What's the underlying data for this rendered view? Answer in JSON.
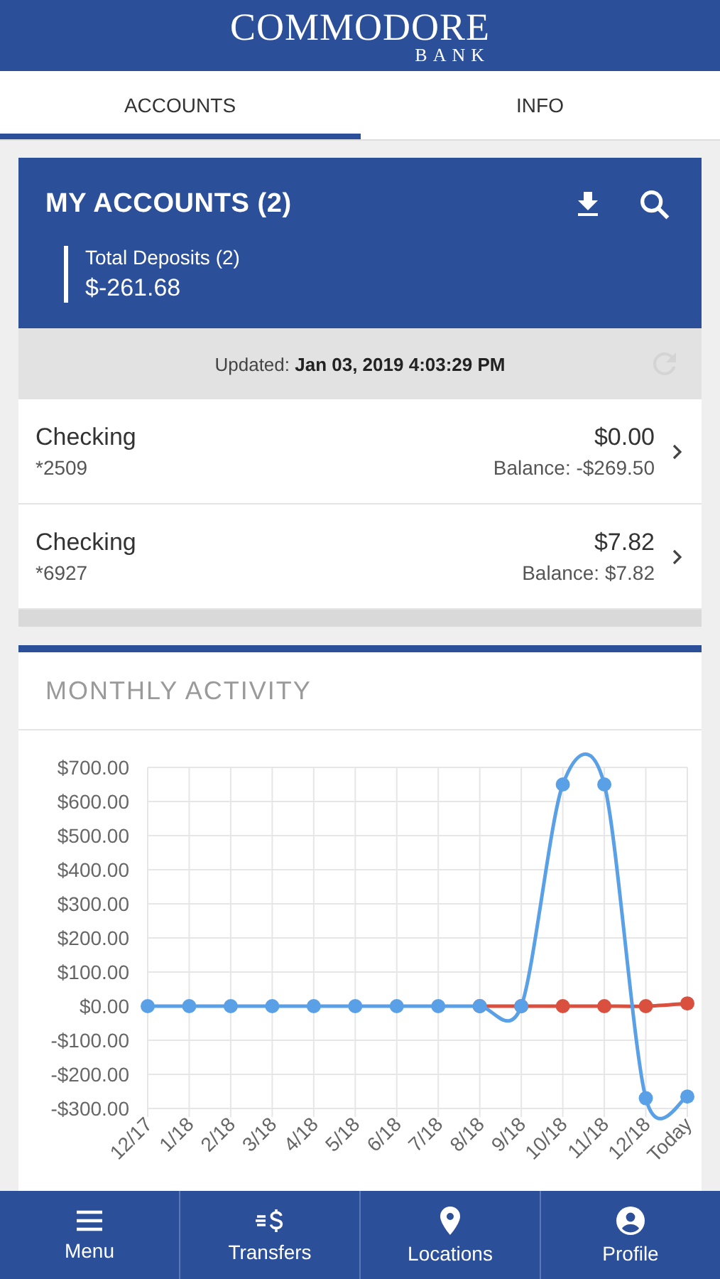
{
  "header": {
    "logo_title": "COMMODORE",
    "logo_subtitle": "BANK"
  },
  "tabs": [
    {
      "label": "ACCOUNTS",
      "selected": true
    },
    {
      "label": "INFO",
      "selected": false
    }
  ],
  "summary": {
    "title": "MY ACCOUNTS (2)",
    "total_label": "Total Deposits (2)",
    "total_value": "$-261.68"
  },
  "updated": {
    "label": "Updated:",
    "value": "Jan 03, 2019 4:03:29 PM"
  },
  "accounts": [
    {
      "name": "Checking",
      "number": "*2509",
      "amount": "$0.00",
      "balance": "Balance: -$269.50"
    },
    {
      "name": "Checking",
      "number": "*6927",
      "amount": "$7.82",
      "balance": "Balance: $7.82"
    }
  ],
  "activity": {
    "title": "MONTHLY ACTIVITY",
    "chart_data": {
      "type": "line",
      "categories": [
        "12/17",
        "1/18",
        "2/18",
        "3/18",
        "4/18",
        "5/18",
        "6/18",
        "7/18",
        "8/18",
        "9/18",
        "10/18",
        "11/18",
        "12/18",
        "Today"
      ],
      "ylim": [
        -300,
        700
      ],
      "grid": true,
      "yticks": [
        {
          "value": 700,
          "label": "$700.00"
        },
        {
          "value": 600,
          "label": "$600.00"
        },
        {
          "value": 500,
          "label": "$500.00"
        },
        {
          "value": 400,
          "label": "$400.00"
        },
        {
          "value": 300,
          "label": "$300.00"
        },
        {
          "value": 200,
          "label": "$200.00"
        },
        {
          "value": 100,
          "label": "$100.00"
        },
        {
          "value": 0,
          "label": "$0.00"
        },
        {
          "value": -100,
          "label": "-$100.00"
        },
        {
          "value": -200,
          "label": "-$200.00"
        },
        {
          "value": -300,
          "label": "-$300.00"
        }
      ],
      "series": [
        {
          "color": "#d9503f",
          "marker": true,
          "values": [
            null,
            null,
            null,
            null,
            null,
            null,
            null,
            null,
            0,
            0,
            0,
            0,
            0,
            8
          ]
        },
        {
          "color": "#5aa0e6",
          "marker": true,
          "values": [
            0,
            0,
            0,
            0,
            0,
            0,
            0,
            0,
            0,
            0,
            650,
            650,
            -270,
            -265
          ]
        }
      ]
    }
  },
  "nav": [
    {
      "label": "Menu",
      "kind": "menu"
    },
    {
      "label": "Transfers",
      "kind": "transfers"
    },
    {
      "label": "Locations",
      "kind": "locations"
    },
    {
      "label": "Profile",
      "kind": "profile"
    }
  ]
}
